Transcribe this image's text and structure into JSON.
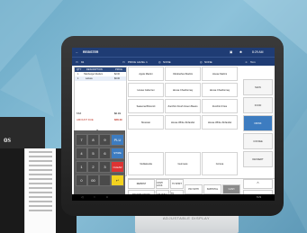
{
  "app": {
    "title": "REGISTER",
    "time": "8:29 AM",
    "stand_label": "ADJUSTABLE DISPLAY",
    "printer_brand": "os"
  },
  "subbar": {
    "items": [
      "91",
      "PRICE LEVEL 1",
      "NONE",
      "NONE",
      "Tom"
    ]
  },
  "order": {
    "headers": [
      "QTY",
      "DESCRIPTION",
      "PRICE"
    ],
    "rows": [
      {
        "qty": "1",
        "desc": "Hamburger Medium",
        "price": "$2.00"
      },
      {
        "qty": "1",
        "desc": "Lettuce",
        "price": "$0.00"
      }
    ],
    "tax_label": "TAX",
    "tax_value": "$0.49",
    "total_label": "AMOUNT DUE",
    "total_value": "$28.49"
  },
  "numpad": {
    "keys": [
      [
        "7",
        "8",
        "9",
        "PLU"
      ],
      [
        "4",
        "5",
        "6",
        "$/TIME"
      ],
      [
        "1",
        "2",
        "3",
        "CLEAR"
      ],
      [
        "0",
        "00",
        "",
        "↵"
      ]
    ]
  },
  "items_grid": [
    [
      "Apple Martini",
      "Oktoberfest Martini",
      "House Martini"
    ],
    [
      "House Cabernet",
      "House Chardonnay",
      "House Chardonnay"
    ],
    [
      "Seasonal Broccoli",
      "Zucchini Fresh Green Beans",
      "Zucchini Fries"
    ],
    [
      "Moscato",
      "House White Zinfandel",
      "House White Zinfandel"
    ],
    [
      "Vodka/soda",
      "Guinness",
      "Corona"
    ]
  ],
  "side_menu": [
    "MAIN",
    "FOOD",
    "DRINK",
    "COFFEE",
    "DESSERT"
  ],
  "bottom": {
    "row1": [
      "REPRINT",
      "CASH LOCK",
      "TO SHIFT",
      "",
      ""
    ],
    "row2": [
      "RECEIPT ON/OFF",
      "SPLIT BILL",
      "TO SUBTOTAL",
      "PAY WITH",
      "SUBTOTAL",
      "CASH"
    ]
  },
  "nav_time": "8:29"
}
